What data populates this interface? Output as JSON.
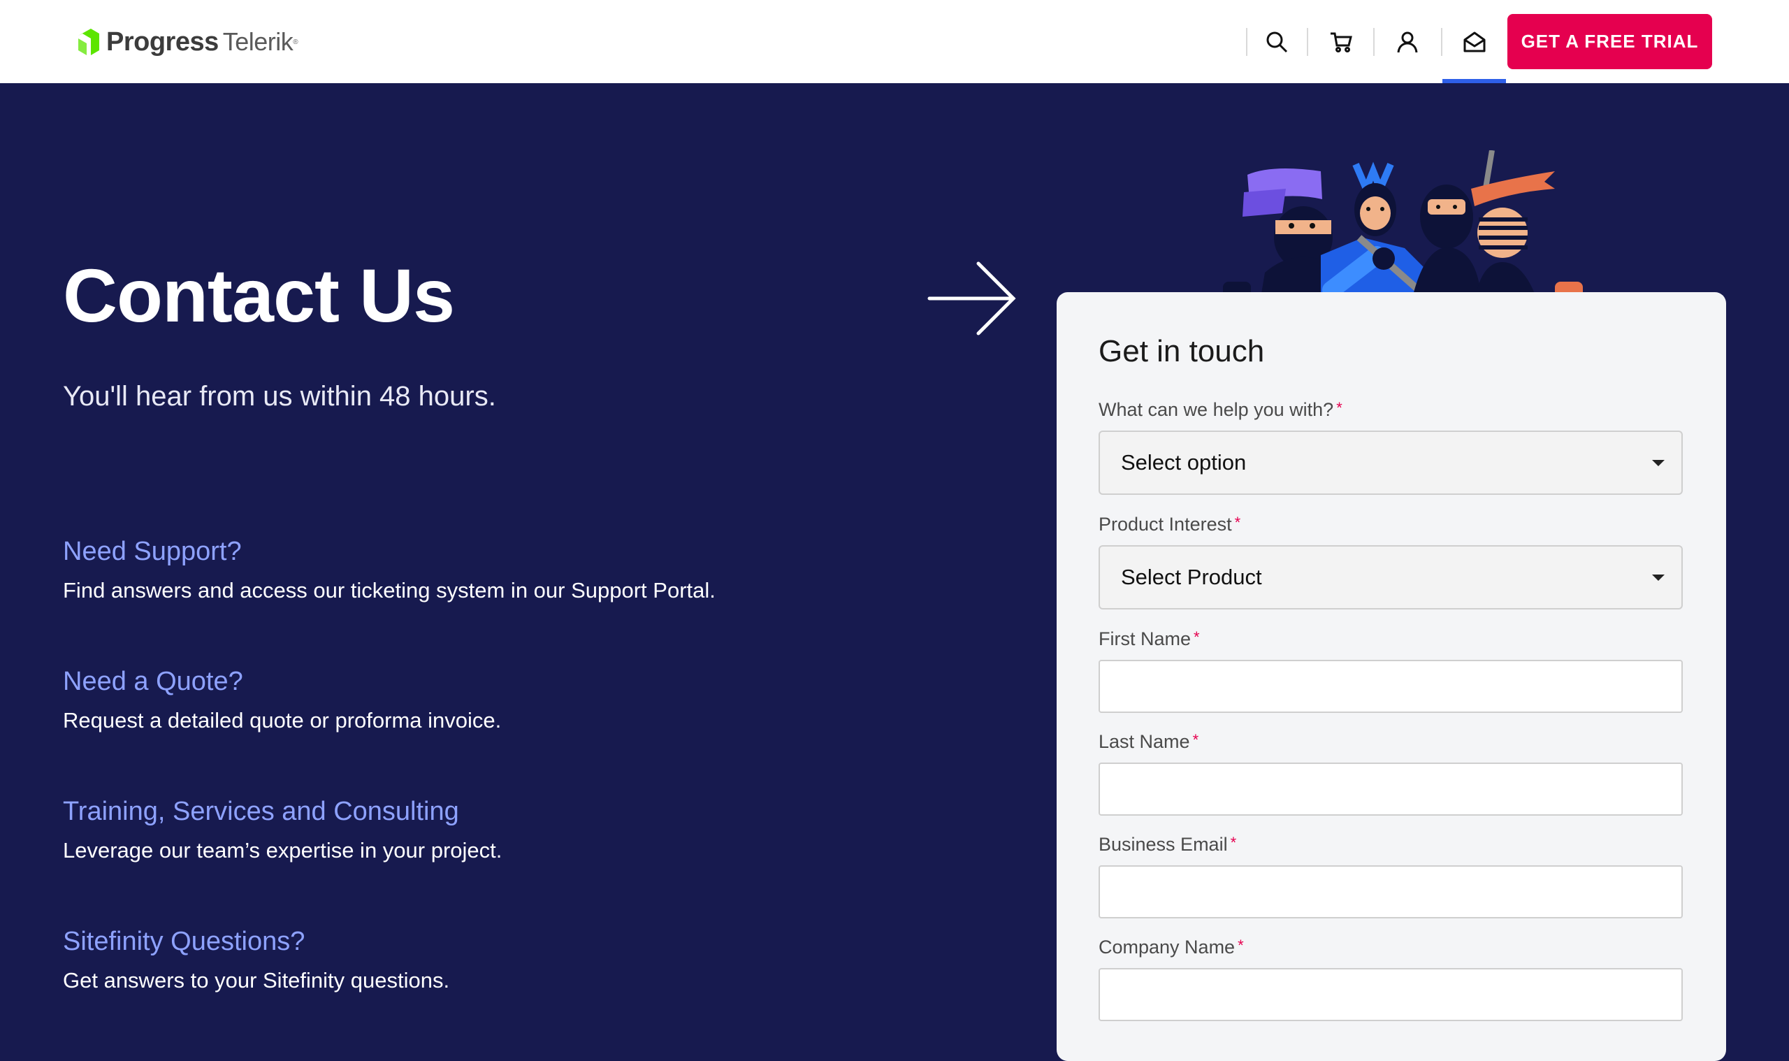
{
  "header": {
    "brand": "Progress",
    "product": "Telerik",
    "trademark": "®",
    "nav_icons": [
      "search-icon",
      "cart-icon",
      "user-icon",
      "mail-icon"
    ],
    "cta_label": "GET A FREE TRIAL",
    "cta_color": "#e5004f",
    "active_indicator_color": "#2e5fe8"
  },
  "hero": {
    "title": "Contact Us",
    "subtitle": "You'll hear from us within 48 hours."
  },
  "info": [
    {
      "title": "Need Support?",
      "description": "Find answers and access our ticketing system in our Support Portal."
    },
    {
      "title": "Need a Quote?",
      "description": "Request a detailed quote or proforma invoice."
    },
    {
      "title": "Training, Services and Consulting",
      "description": "Leverage our team’s expertise in your project."
    },
    {
      "title": "Sitefinity Questions?",
      "description": "Get answers to your Sitefinity questions."
    }
  ],
  "form": {
    "title": "Get in touch",
    "required_marker": "*",
    "fields": [
      {
        "label": "What can we help you with?",
        "value": "Select option"
      },
      {
        "label": "Product Interest",
        "value": "Select Product"
      },
      {
        "label": "First Name",
        "value": ""
      },
      {
        "label": "Last Name",
        "value": ""
      },
      {
        "label": "Business Email",
        "value": ""
      },
      {
        "label": "Company Name",
        "value": ""
      }
    ]
  },
  "colors": {
    "background": "#171a4f",
    "link": "#8ea2ff",
    "card": "#f4f5f7"
  }
}
